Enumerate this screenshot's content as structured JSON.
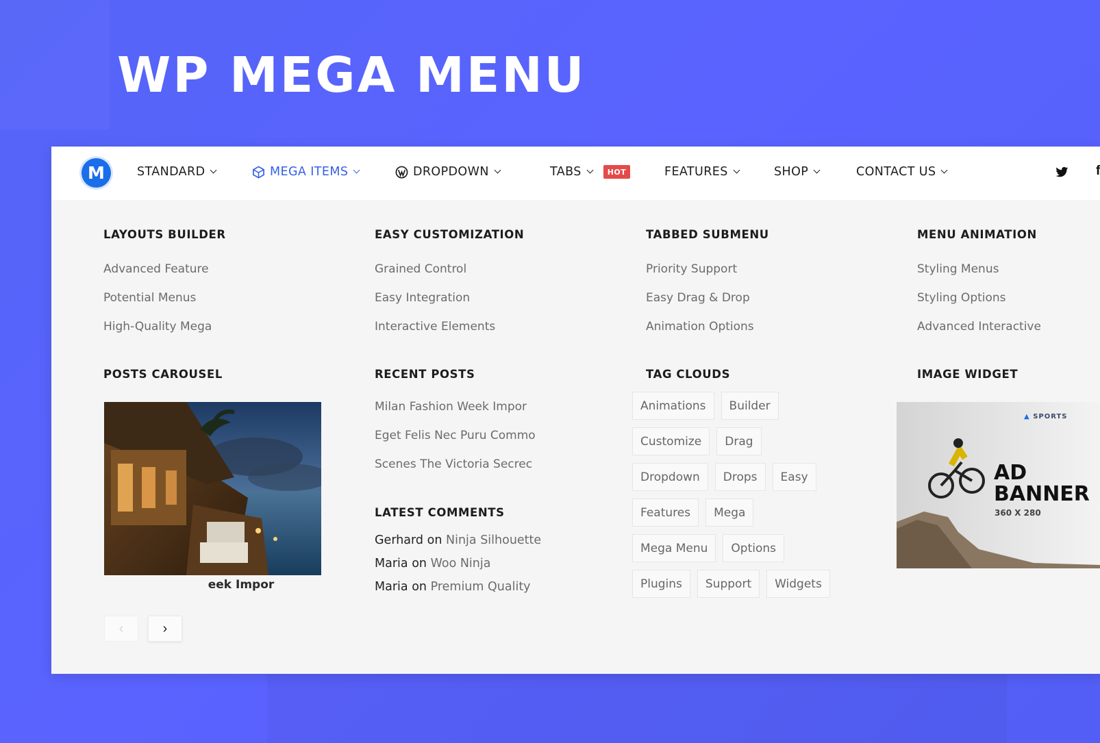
{
  "hero": {
    "title": "WP MEGA MENU"
  },
  "colors": {
    "background": "#5564f8",
    "accent": "#3560e6",
    "hot": "#e54a4a",
    "logo": "#1b6ee9"
  },
  "nav": {
    "logo_letter": "M",
    "items": [
      {
        "label": "STANDARD",
        "icon": ""
      },
      {
        "label": "MEGA ITEMS",
        "icon": "cube-icon"
      },
      {
        "label": "DROPDOWN",
        "icon": "wordpress-icon"
      },
      {
        "label": "TABS",
        "icon": "",
        "badge": "HOT"
      },
      {
        "label": "FEATURES",
        "icon": ""
      },
      {
        "label": "SHOP",
        "icon": ""
      },
      {
        "label": "CONTACT US",
        "icon": ""
      }
    ],
    "social": [
      "twitter-icon",
      "facebook-icon"
    ]
  },
  "sections": {
    "layouts": {
      "title": "LAYOUTS BUILDER",
      "links": [
        "Advanced Feature",
        "Potential Menus",
        "High-Quality Mega"
      ]
    },
    "customization": {
      "title": "EASY CUSTOMIZATION",
      "links": [
        "Grained Control",
        "Easy Integration",
        "Interactive Elements"
      ]
    },
    "tabbed": {
      "title": "TABBED SUBMENU",
      "links": [
        "Priority Support",
        "Easy Drag & Drop",
        "Animation Options"
      ]
    },
    "animation": {
      "title": "MENU ANIMATION",
      "links": [
        "Styling Menus",
        "Styling Options",
        "Advanced Interactive"
      ]
    }
  },
  "posts_carousel": {
    "title": "POSTS CAROUSEL",
    "caption": "eek Impor"
  },
  "recent_posts": {
    "title": "RECENT POSTS",
    "items": [
      "Milan Fashion Week Impor",
      "Eget Felis Nec Puru Commo",
      "Scenes The Victoria Secrec"
    ]
  },
  "latest_comments": {
    "title": "LATEST COMMENTS",
    "connector": "on",
    "items": [
      {
        "author": "Gerhard",
        "post": "Ninja Silhouette"
      },
      {
        "author": "Maria",
        "post": "Woo Ninja"
      },
      {
        "author": "Maria",
        "post": "Premium Quality"
      }
    ]
  },
  "tag_clouds": {
    "title": "TAG CLOUDS",
    "rows": [
      [
        "Animations",
        "Builder"
      ],
      [
        "Customize",
        "Drag"
      ],
      [
        "Dropdown",
        "Drops",
        "Easy"
      ],
      [
        "Features",
        "Mega"
      ],
      [
        "Mega Menu",
        "Options"
      ],
      [
        "Plugins",
        "Support",
        "Widgets"
      ]
    ]
  },
  "image_widget": {
    "title": "IMAGE WIDGET",
    "brand": "SPORTS",
    "ad_line1": "AD",
    "ad_line2": "BANNER",
    "ad_size": "360 X 280"
  }
}
